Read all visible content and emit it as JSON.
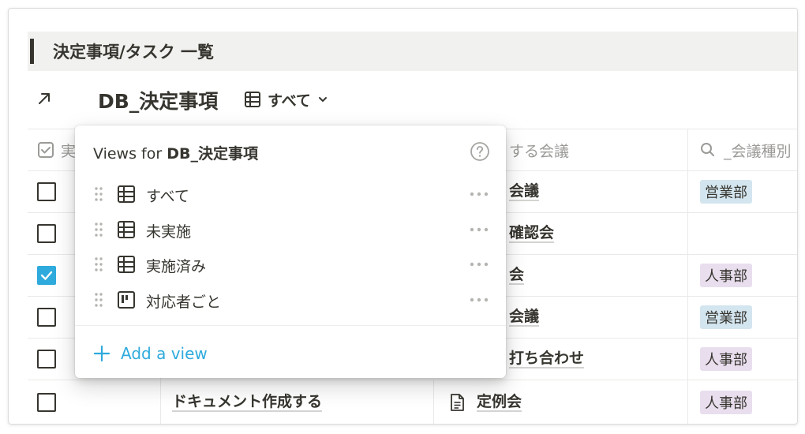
{
  "section": {
    "title": "決定事項/タスク 一覧"
  },
  "database": {
    "title": "DB_決定事項",
    "current_view": "すべて"
  },
  "table": {
    "headers": {
      "status_partial": "実",
      "meeting_partial": "する会議",
      "meeting_type_partial": "_会議種別"
    },
    "rows": [
      {
        "checked": false,
        "task": "",
        "meeting_partial": "会議",
        "tag": "営業部",
        "tag_kind": "sales"
      },
      {
        "checked": false,
        "task": "",
        "meeting_partial": "確認会",
        "tag": "",
        "tag_kind": ""
      },
      {
        "checked": true,
        "task": "",
        "meeting_partial": "会",
        "tag": "人事部",
        "tag_kind": "hr"
      },
      {
        "checked": false,
        "task": "",
        "meeting_partial": "会議",
        "tag": "営業部",
        "tag_kind": "sales"
      },
      {
        "checked": false,
        "task": "",
        "meeting_partial": "打ち合わせ",
        "tag": "人事部",
        "tag_kind": "hr"
      },
      {
        "checked": false,
        "task": "ドキュメント作成する",
        "meeting": "定例会",
        "tag": "人事部",
        "tag_kind": "hr"
      }
    ]
  },
  "views_popup": {
    "title_prefix": "Views for ",
    "db_name": "DB_決定事項",
    "items": [
      {
        "label": "すべて",
        "icon": "table-icon"
      },
      {
        "label": "未実施",
        "icon": "table-icon"
      },
      {
        "label": "実施済み",
        "icon": "table-icon"
      },
      {
        "label": "対応者ごと",
        "icon": "board-icon"
      }
    ],
    "add_label": "Add a view"
  },
  "colors": {
    "accent": "#2eaadc",
    "tag_sales": "#d3e5ef",
    "tag_hr": "#e8deee",
    "text": "#37352f",
    "muted": "#9b9a97"
  }
}
